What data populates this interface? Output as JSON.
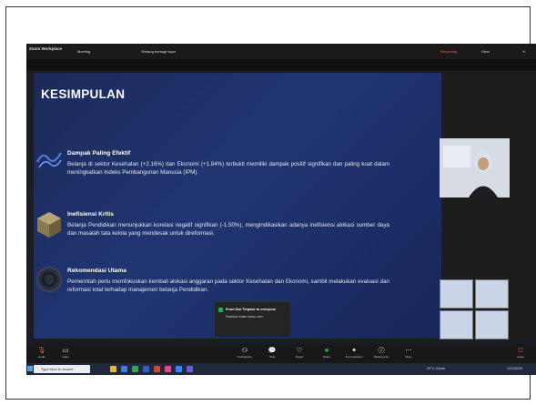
{
  "zoom_window": {
    "app_label": "Zoom Workplace",
    "meeting_label": "Meeting",
    "share_label": "Sedang berbagi layar",
    "rec_label": "Recording",
    "view_label": "View"
  },
  "slide": {
    "title": "KESIMPULAN",
    "sections": [
      {
        "heading": "Dampak Paling Efektif",
        "body": "Belanja di sektor Kesehatan (+2.16%) dan Ekonomi (+1.84%) terbukti memiliki dampak positif signifikan dan paling kuat dalam meningkatkan Indeks Pembangunan Manusia (IPM)."
      },
      {
        "heading": "Inefisiensi Kritis",
        "body": "Belanja Pendidikan menunjukkan korelasi negatif signifikan (-1.50%), mengindikasikan adanya inefisiensi alokasi sumber daya dan masalah tata kelola yang mendesak untuk direformasi."
      },
      {
        "heading": "Rekomendasi Utama",
        "body": "Pemerintah perlu memfokuskan kembali alokasi anggaran pada sektor Kesehatan dan Ekonomi, sambil melakukan evaluasi dan reformasi total terhadap manajemen belanja Pendidikan."
      }
    ]
  },
  "chat_popup": {
    "from": "From Dwi Terpase to everyone",
    "message": "Pastikan kalau kalau cam"
  },
  "controls": [
    {
      "icon": "microphone-icon",
      "label": "Audio"
    },
    {
      "icon": "video-icon",
      "label": "Video"
    },
    {
      "icon": "participants-icon",
      "label": "Participants"
    },
    {
      "icon": "chat-icon",
      "label": "Chat"
    },
    {
      "icon": "react-icon",
      "label": "React"
    },
    {
      "icon": "share-icon",
      "label": "Share"
    },
    {
      "icon": "ai-companion-icon",
      "label": "AI Companion"
    },
    {
      "icon": "info-icon",
      "label": "Meeting info"
    },
    {
      "icon": "more-icon",
      "label": "More"
    },
    {
      "icon": "leave-icon",
      "label": "Leave"
    }
  ],
  "taskbar": {
    "search_placeholder": "Type here to search",
    "weather": "29°C Cerah",
    "clock": "12/12/2025"
  },
  "colors": {
    "slide_bg": "#1f3170",
    "accent_green": "#2eaa4a",
    "leave_red": "#e0443e"
  }
}
